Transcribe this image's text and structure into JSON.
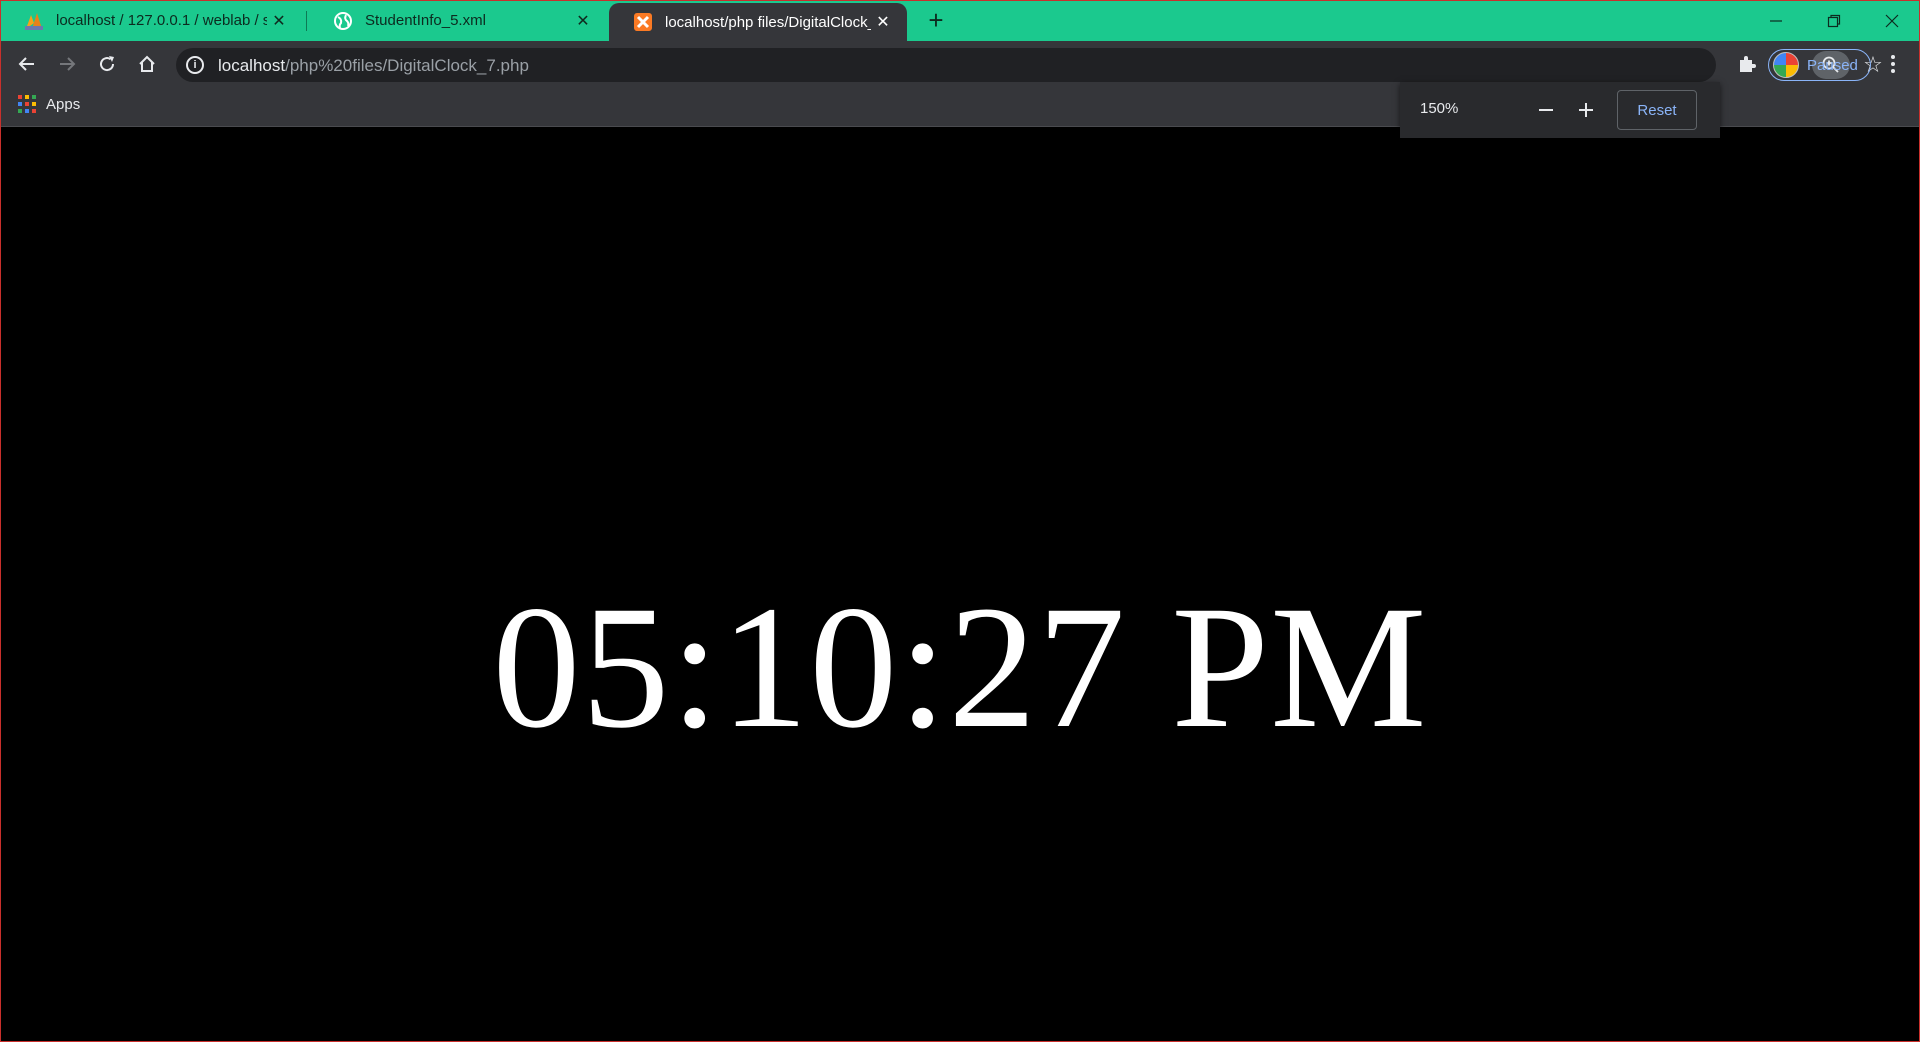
{
  "tabs": [
    {
      "title": "localhost / 127.0.0.1 / weblab / st",
      "icon": "phpmyadmin-icon",
      "active": false
    },
    {
      "title": "StudentInfo_5.xml",
      "icon": "globe-icon",
      "active": false
    },
    {
      "title": "localhost/php files/DigitalClock_7",
      "icon": "xampp-icon",
      "active": true
    }
  ],
  "toolbar": {
    "url_host": "localhost",
    "url_path": "/php%20files/DigitalClock_7.php",
    "profile_label": "Paused"
  },
  "bookmarks": {
    "apps_label": "Apps"
  },
  "zoom_bubble": {
    "level": "150%",
    "reset_label": "Reset"
  },
  "page": {
    "clock_text": "05:10:27 PM"
  },
  "colors": {
    "tabstrip": "#1bc98e",
    "toolbar": "#35363a",
    "omnibox": "#202124",
    "accent": "#8ab4f8",
    "page_bg": "#000000",
    "clock_text": "#ffffff"
  }
}
